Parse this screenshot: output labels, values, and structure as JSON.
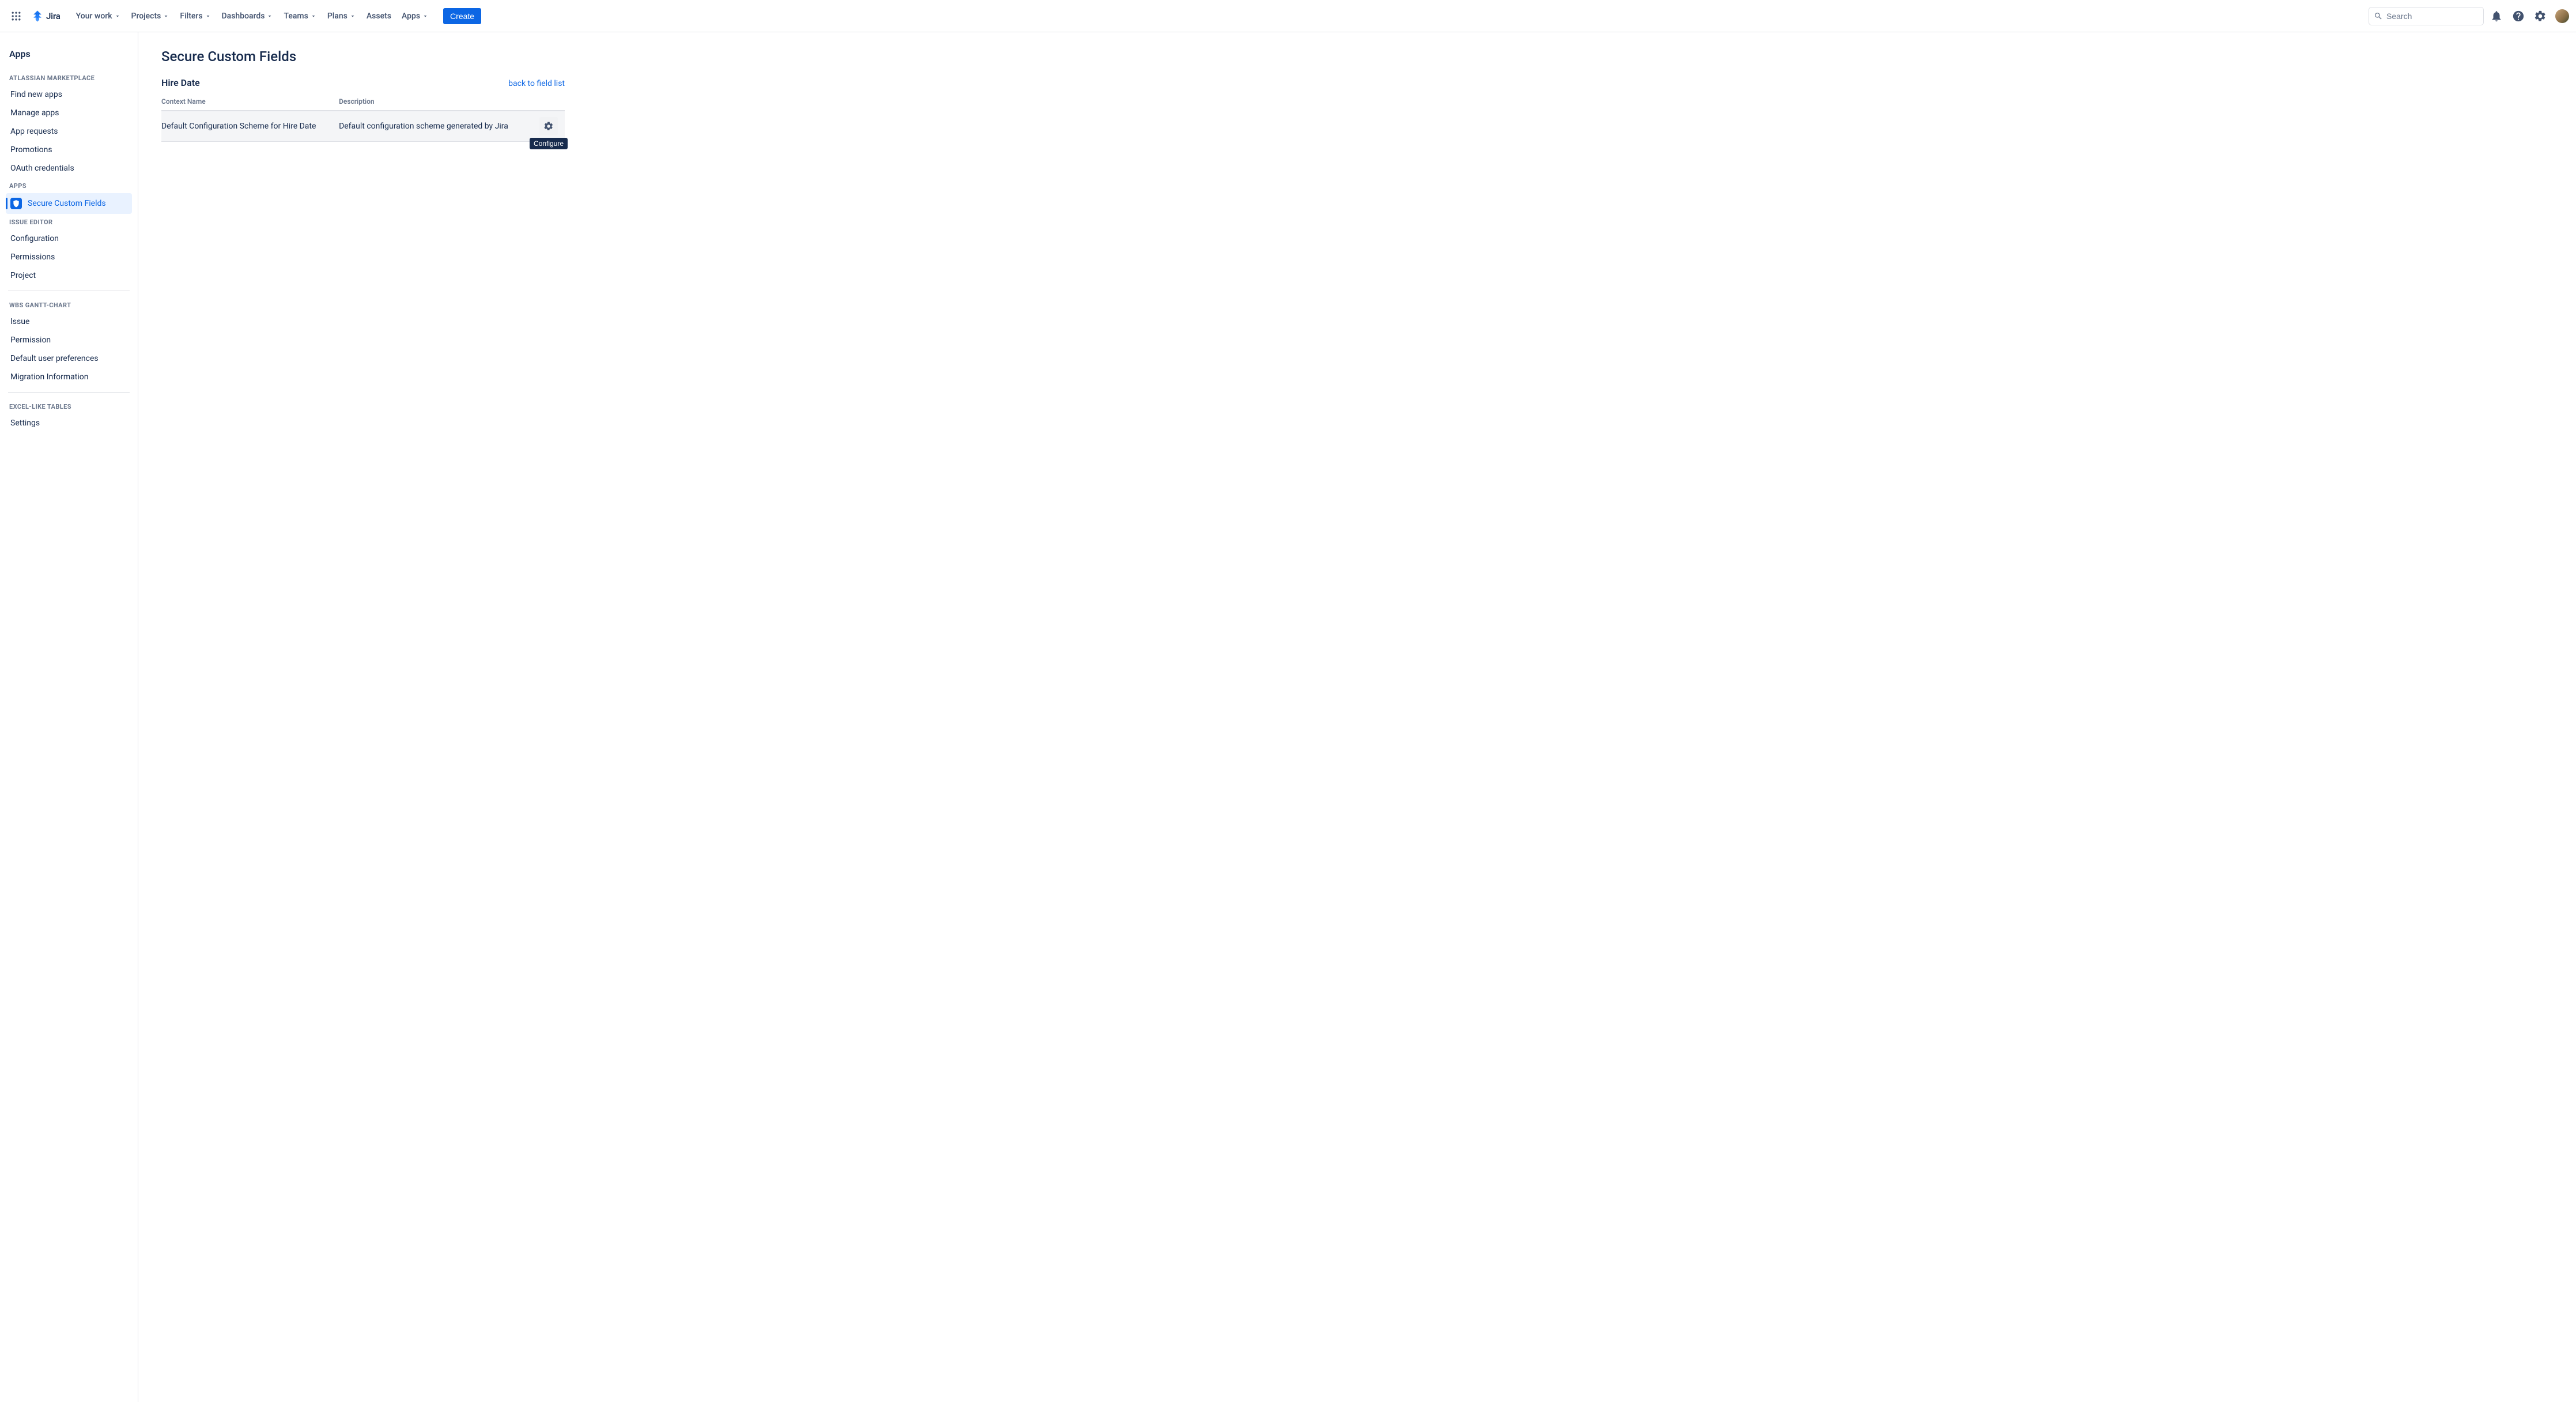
{
  "product_name": "Jira",
  "topnav": {
    "items": [
      {
        "label": "Your work",
        "has_chevron": true
      },
      {
        "label": "Projects",
        "has_chevron": true
      },
      {
        "label": "Filters",
        "has_chevron": true
      },
      {
        "label": "Dashboards",
        "has_chevron": true
      },
      {
        "label": "Teams",
        "has_chevron": true
      },
      {
        "label": "Plans",
        "has_chevron": true
      },
      {
        "label": "Assets",
        "has_chevron": false
      },
      {
        "label": "Apps",
        "has_chevron": true
      }
    ],
    "create_label": "Create",
    "search_placeholder": "Search"
  },
  "sidebar": {
    "title": "Apps",
    "groups": [
      {
        "label": "Atlassian Marketplace",
        "items": [
          {
            "label": "Find new apps"
          },
          {
            "label": "Manage apps"
          },
          {
            "label": "App requests"
          },
          {
            "label": "Promotions"
          },
          {
            "label": "OAuth credentials"
          }
        ]
      },
      {
        "label": "Apps",
        "items": [
          {
            "label": "Secure Custom Fields",
            "selected": true,
            "icon": "shield"
          }
        ]
      },
      {
        "label": "Issue Editor",
        "items": [
          {
            "label": "Configuration"
          },
          {
            "label": "Permissions"
          },
          {
            "label": "Project"
          }
        ]
      },
      {
        "label": "WBS Gantt-Chart",
        "items": [
          {
            "label": "Issue"
          },
          {
            "label": "Permission"
          },
          {
            "label": "Default user preferences"
          },
          {
            "label": "Migration Information"
          }
        ]
      },
      {
        "label": "Excel-like Tables",
        "items": [
          {
            "label": "Settings"
          }
        ]
      }
    ]
  },
  "page": {
    "title": "Secure Custom Fields",
    "field_name": "Hire Date",
    "back_link_label": "back to field list",
    "table": {
      "headers": {
        "context_name": "Context Name",
        "description": "Description"
      },
      "rows": [
        {
          "context_name": "Default Configuration Scheme for Hire Date",
          "description": "Default configuration scheme generated by Jira",
          "action_tooltip": "Configure"
        }
      ]
    }
  }
}
